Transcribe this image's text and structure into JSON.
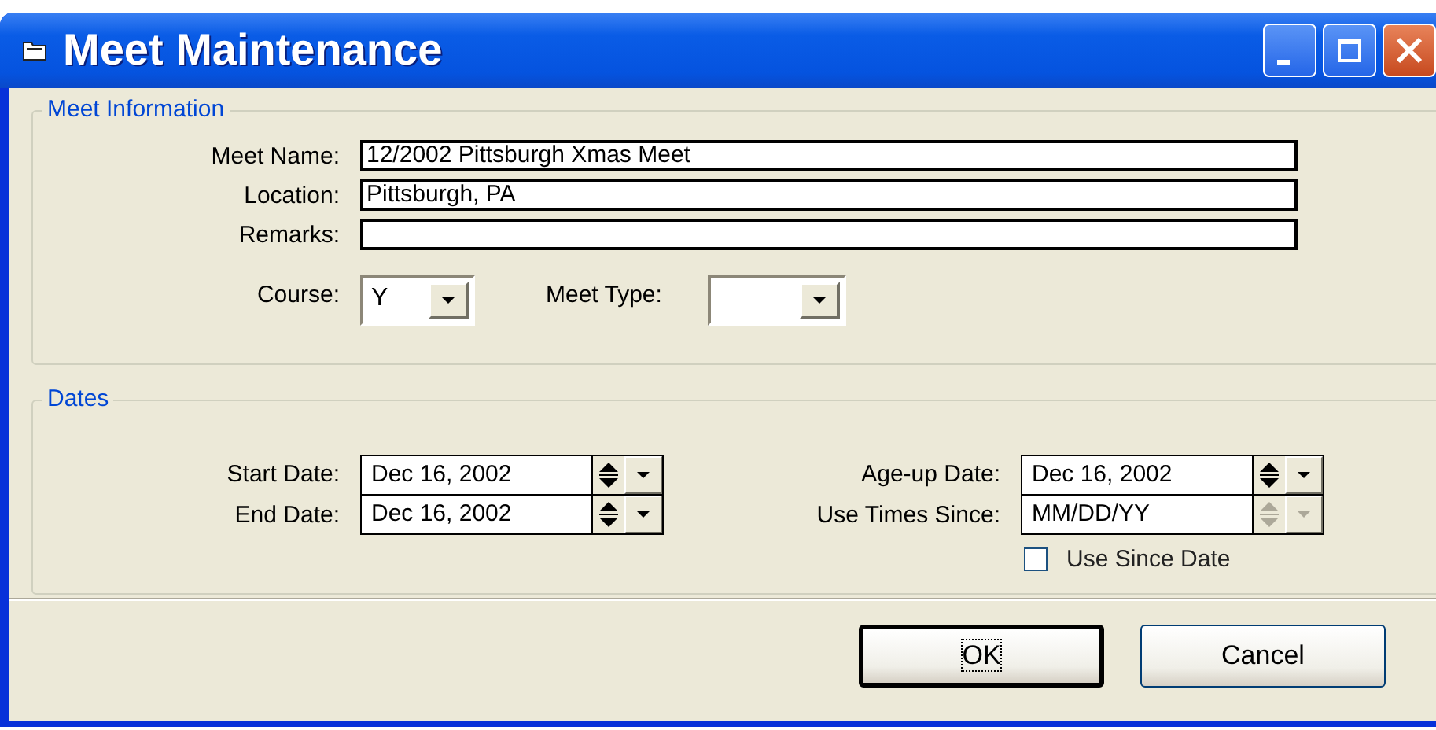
{
  "window": {
    "title": "Meet Maintenance"
  },
  "meet_information": {
    "legend": "Meet Information",
    "fields": [
      {
        "label": "Meet Name:",
        "value": "12/2002 Pittsburgh Xmas Meet"
      },
      {
        "label": "Location:",
        "value": "Pittsburgh, PA"
      },
      {
        "label": "Remarks:"
      }
    ],
    "course": {
      "label": "Course:",
      "value": "Y"
    },
    "meet_type": {
      "label": "Meet Type:"
    }
  },
  "dates": {
    "legend": "Dates",
    "left": [
      {
        "label": "Start Date:",
        "value": "Dec 16, 2002",
        "disabled": false
      },
      {
        "label": "End Date:",
        "value": "Dec 16, 2002",
        "disabled": false
      }
    ],
    "right": [
      {
        "label": "Age-up Date:",
        "value": "Dec 16, 2002",
        "disabled": false
      },
      {
        "label": "Use Times Since:",
        "value": "MM/DD/YY",
        "disabled": true
      }
    ],
    "use_since_date": {
      "label": "Use Since Date",
      "checked": false
    }
  },
  "buttons": [
    {
      "label": "OK",
      "focused": true
    },
    {
      "label": "Cancel",
      "focused": false
    }
  ]
}
